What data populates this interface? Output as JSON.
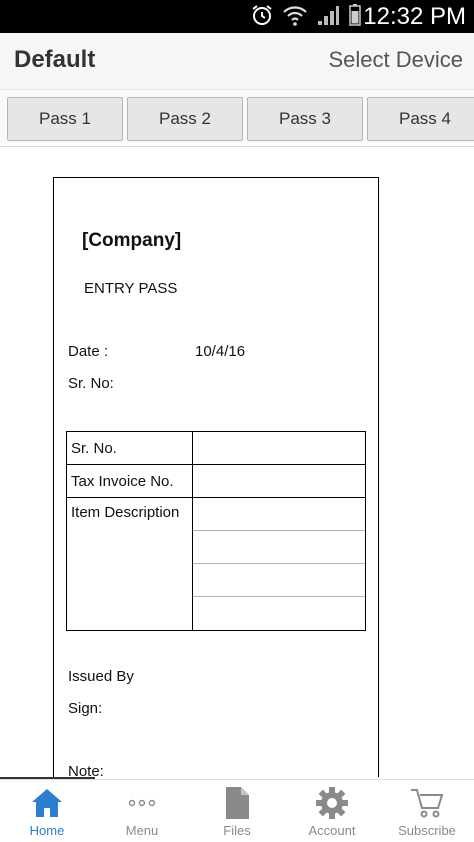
{
  "status_bar": {
    "time": "12:32 PM",
    "icons": [
      "alarm-icon",
      "wifi-icon",
      "signal-icon",
      "battery-icon"
    ]
  },
  "header": {
    "title": "Default",
    "select_device": "Select Device"
  },
  "tabs": [
    {
      "label": "Pass 1"
    },
    {
      "label": "Pass 2"
    },
    {
      "label": "Pass 3"
    },
    {
      "label": "Pass 4"
    }
  ],
  "document": {
    "company": "[Company]",
    "heading": "ENTRY PASS",
    "date_label": "Date :",
    "date_value": "10/4/16",
    "sr_no_label": "Sr. No:",
    "table": {
      "rows": [
        {
          "label": "Sr. No."
        },
        {
          "label": "Tax Invoice No."
        },
        {
          "label": "Item Description"
        }
      ]
    },
    "issued_by_label": "Issued By",
    "sign_label": "Sign:",
    "note_label": "Note:"
  },
  "bottom_nav": {
    "accent_color": "#2d7dd2",
    "items": [
      {
        "label": "Home",
        "icon": "home-icon"
      },
      {
        "label": "Menu",
        "icon": "more-dots-icon"
      },
      {
        "label": "Files",
        "icon": "file-icon"
      },
      {
        "label": "Account",
        "icon": "gear-icon"
      },
      {
        "label": "Subscribe",
        "icon": "cart-icon"
      }
    ]
  }
}
